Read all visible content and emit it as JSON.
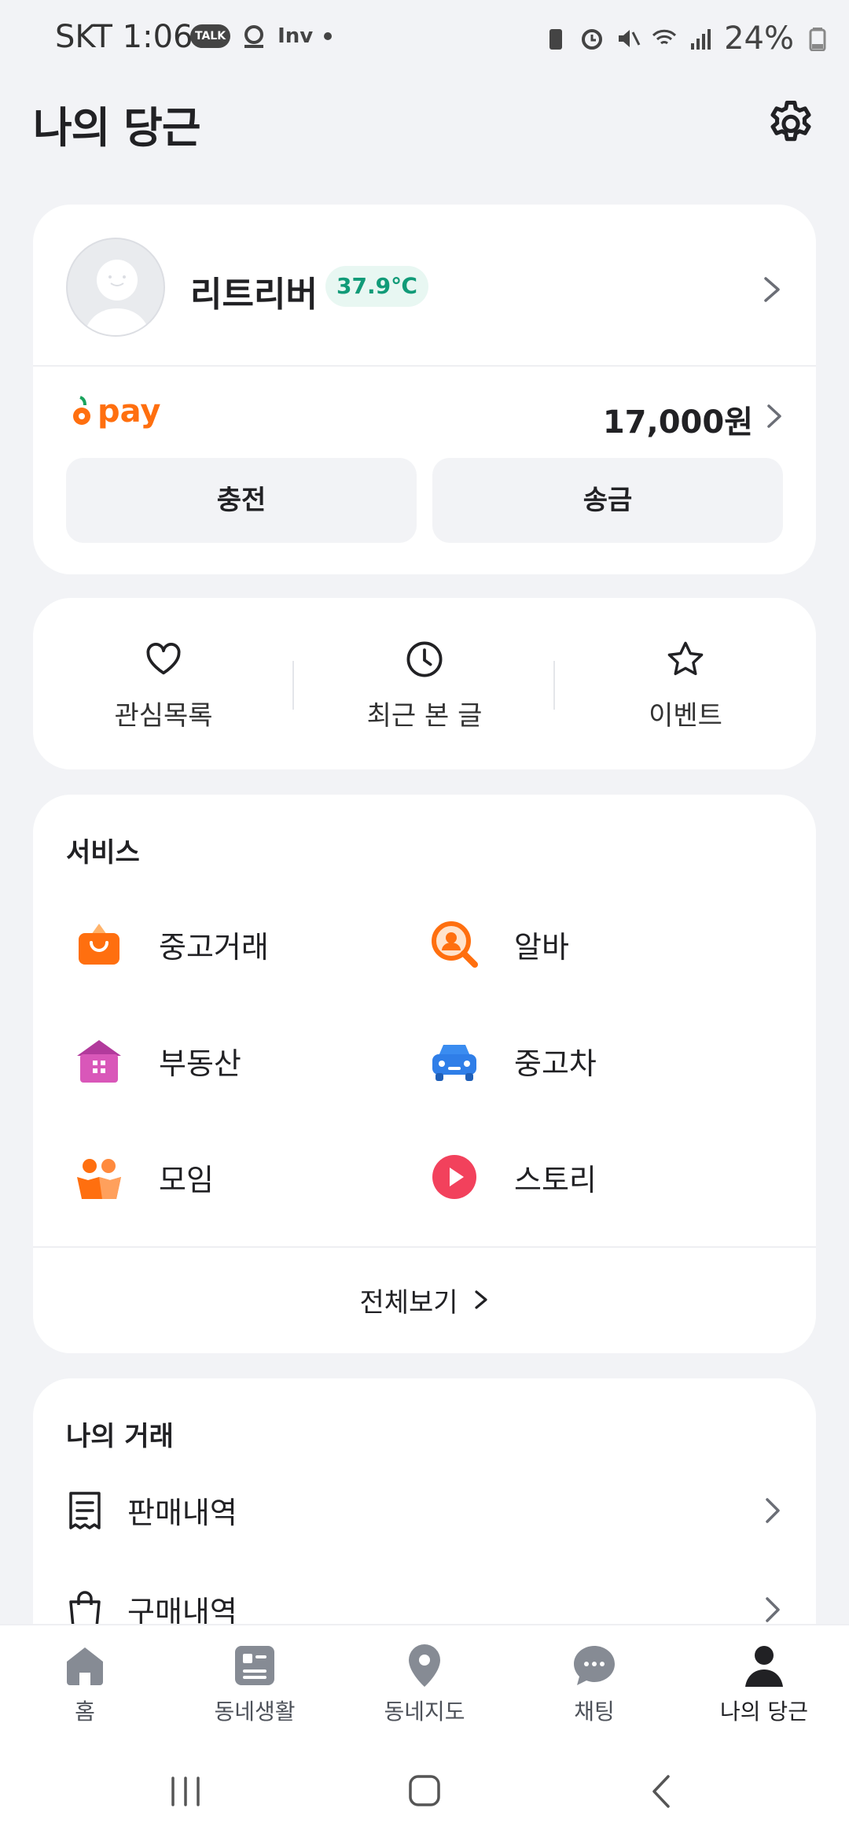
{
  "status_bar": {
    "carrier_time": "SKT 1:06",
    "talk_badge": "TALK",
    "inv_label": "Inv",
    "battery": "24%"
  },
  "header": {
    "title": "나의 당근"
  },
  "profile": {
    "name": "리트리버",
    "temperature": "37.9℃"
  },
  "pay": {
    "logo_text": "pay",
    "balance": "17,000원",
    "charge_label": "충전",
    "send_label": "송금"
  },
  "quick_links": [
    {
      "label": "관심목록",
      "icon": "heart-icon"
    },
    {
      "label": "최근 본 글",
      "icon": "clock-icon"
    },
    {
      "label": "이벤트",
      "icon": "star-icon"
    }
  ],
  "services": {
    "title": "서비스",
    "items": [
      {
        "label": "중고거래",
        "icon": "shopping-bag-icon"
      },
      {
        "label": "알바",
        "icon": "job-search-icon"
      },
      {
        "label": "부동산",
        "icon": "house-icon"
      },
      {
        "label": "중고차",
        "icon": "car-icon"
      },
      {
        "label": "모임",
        "icon": "group-icon"
      },
      {
        "label": "스토리",
        "icon": "play-icon"
      }
    ],
    "view_all": "전체보기"
  },
  "my_trades": {
    "title": "나의 거래",
    "items": [
      {
        "label": "판매내역",
        "icon": "receipt-icon"
      },
      {
        "label": "구매내역",
        "icon": "bag-icon"
      }
    ]
  },
  "bottom_nav": [
    {
      "label": "홈",
      "icon": "home-icon"
    },
    {
      "label": "동네생활",
      "icon": "community-icon"
    },
    {
      "label": "동네지도",
      "icon": "map-pin-icon"
    },
    {
      "label": "채팅",
      "icon": "chat-icon"
    },
    {
      "label": "나의 당근",
      "icon": "person-icon",
      "active": true
    }
  ],
  "colors": {
    "accent": "#ff6f0f",
    "temperature": "#119b78",
    "background": "#f2f3f6"
  }
}
